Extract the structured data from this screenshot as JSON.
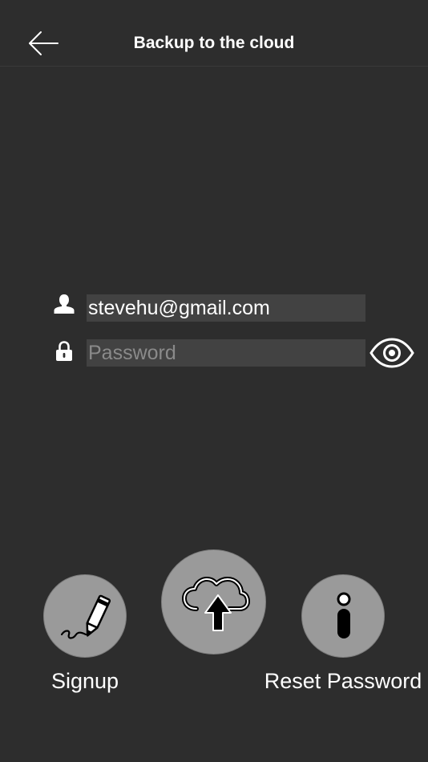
{
  "header": {
    "title": "Backup to the cloud",
    "back_icon": "arrow-left-icon"
  },
  "form": {
    "email": {
      "value": "stevehu@gmail.com",
      "icon": "user-icon"
    },
    "password": {
      "value": "",
      "placeholder": "Password",
      "icon": "lock-icon",
      "toggle_icon": "eye-icon"
    }
  },
  "actions": {
    "signup": {
      "label": "Signup",
      "icon": "pen-icon"
    },
    "upload": {
      "label": "",
      "icon": "cloud-upload-icon"
    },
    "reset": {
      "label": "Reset Password",
      "icon": "info-icon"
    }
  },
  "colors": {
    "background": "#2d2d2d",
    "field": "#424242",
    "button": "#9a9a9a"
  }
}
